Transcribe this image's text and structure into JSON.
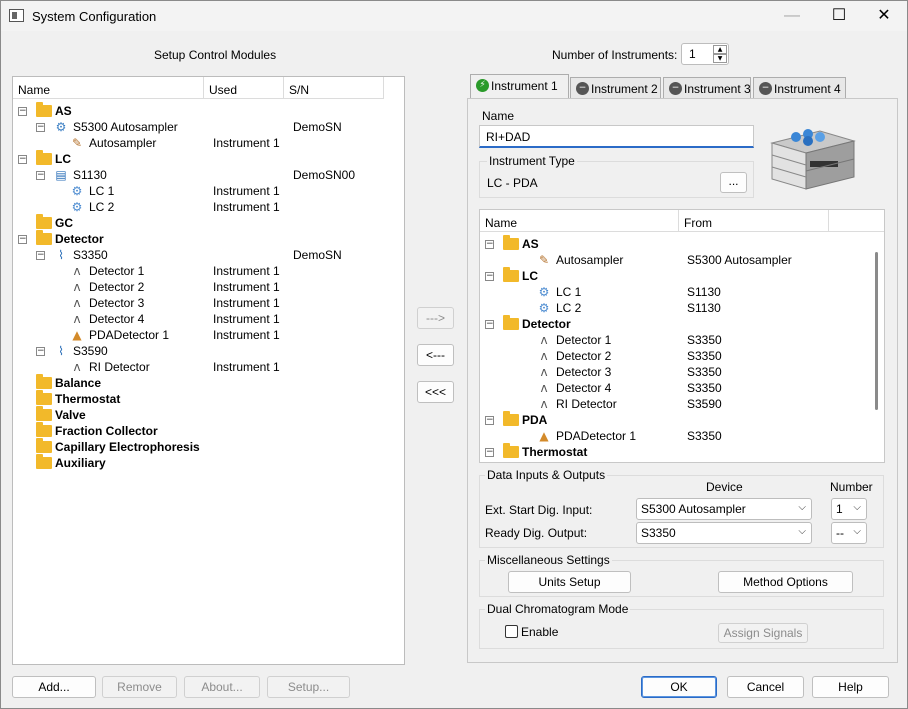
{
  "window": {
    "title": "System Configuration",
    "min_icon": "—",
    "max_icon": "☐",
    "close_icon": "✕"
  },
  "left": {
    "section_title": "Setup Control Modules",
    "columns": [
      "Name",
      "Used",
      "S/N"
    ],
    "rows": [
      {
        "name": "AS",
        "bold": true,
        "kind": "folder",
        "exp": "−",
        "used": "",
        "sn": ""
      },
      {
        "name": "S5300 Autosampler",
        "kind": "autosampler",
        "exp": "−",
        "used": "",
        "sn": "DemoSN"
      },
      {
        "name": "Autosampler",
        "kind": "needle",
        "used": "Instrument 1",
        "sn": ""
      },
      {
        "name": "LC",
        "bold": true,
        "kind": "folder",
        "exp": "−",
        "used": "",
        "sn": ""
      },
      {
        "name": "S1130",
        "kind": "pump",
        "exp": "−",
        "used": "",
        "sn": "DemoSN00"
      },
      {
        "name": "LC 1",
        "kind": "lc",
        "used": "Instrument 1",
        "sn": ""
      },
      {
        "name": "LC 2",
        "kind": "lc",
        "used": "Instrument 1",
        "sn": ""
      },
      {
        "name": "GC",
        "bold": true,
        "kind": "folder",
        "used": "",
        "sn": ""
      },
      {
        "name": "Detector",
        "bold": true,
        "kind": "folder",
        "exp": "−",
        "used": "",
        "sn": ""
      },
      {
        "name": "S3350",
        "kind": "detbox",
        "exp": "−",
        "used": "",
        "sn": "DemoSN"
      },
      {
        "name": "Detector 1",
        "kind": "wave",
        "used": "Instrument 1",
        "sn": ""
      },
      {
        "name": "Detector 2",
        "kind": "wave",
        "used": "Instrument 1",
        "sn": ""
      },
      {
        "name": "Detector 3",
        "kind": "wave",
        "used": "Instrument 1",
        "sn": ""
      },
      {
        "name": "Detector 4",
        "kind": "wave",
        "used": "Instrument 1",
        "sn": ""
      },
      {
        "name": "PDADetector 1",
        "kind": "pda",
        "used": "Instrument 1",
        "sn": ""
      },
      {
        "name": "S3590",
        "kind": "detbox",
        "exp": "−",
        "used": "",
        "sn": ""
      },
      {
        "name": "RI Detector",
        "kind": "wave",
        "used": "Instrument 1",
        "sn": ""
      },
      {
        "name": "Balance",
        "bold": true,
        "kind": "folder",
        "used": "",
        "sn": ""
      },
      {
        "name": "Thermostat",
        "bold": true,
        "kind": "folder",
        "used": "",
        "sn": ""
      },
      {
        "name": "Valve",
        "bold": true,
        "kind": "folder",
        "used": "",
        "sn": ""
      },
      {
        "name": "Fraction Collector",
        "bold": true,
        "kind": "folder",
        "used": "",
        "sn": ""
      },
      {
        "name": "Capillary Electrophoresis",
        "bold": true,
        "kind": "folder",
        "used": "",
        "sn": ""
      },
      {
        "name": "Auxiliary",
        "bold": true,
        "kind": "folder",
        "used": "",
        "sn": ""
      }
    ],
    "buttons": {
      "add": "Add...",
      "remove": "Remove",
      "about": "About...",
      "setup": "Setup..."
    }
  },
  "middle": {
    "assign": "--->",
    "unassign": "<---",
    "unassign_all": "<<<"
  },
  "instruments": {
    "count_label": "Number of Instruments:",
    "count": "1",
    "tabs": [
      {
        "label": "Instrument 1",
        "icon": "⚡",
        "active": true
      },
      {
        "label": "Instrument 2",
        "icon": "−"
      },
      {
        "label": "Instrument 3",
        "icon": "−"
      },
      {
        "label": "Instrument 4",
        "icon": "−"
      }
    ],
    "name_label": "Name",
    "name_value": "RI+DAD",
    "type_group": "Instrument Type",
    "type_value": "LC - PDA",
    "type_button": "...",
    "columns": [
      "Name",
      "From"
    ],
    "rows": [
      {
        "name": "AS",
        "bold": true,
        "kind": "folder",
        "exp": "−",
        "from": ""
      },
      {
        "name": "Autosampler",
        "kind": "needle",
        "from": "S5300 Autosampler"
      },
      {
        "name": "LC",
        "bold": true,
        "kind": "folder",
        "exp": "−",
        "from": ""
      },
      {
        "name": "LC 1",
        "kind": "lc",
        "from": "S1130"
      },
      {
        "name": "LC 2",
        "kind": "lc",
        "from": "S1130"
      },
      {
        "name": "Detector",
        "bold": true,
        "kind": "folder",
        "exp": "−",
        "from": ""
      },
      {
        "name": "Detector 1",
        "kind": "wave",
        "from": "S3350"
      },
      {
        "name": "Detector 2",
        "kind": "wave",
        "from": "S3350"
      },
      {
        "name": "Detector 3",
        "kind": "wave",
        "from": "S3350"
      },
      {
        "name": "Detector 4",
        "kind": "wave",
        "from": "S3350"
      },
      {
        "name": "RI Detector",
        "kind": "wave",
        "from": "S3590"
      },
      {
        "name": "PDA",
        "bold": true,
        "kind": "folder",
        "exp": "−",
        "from": ""
      },
      {
        "name": "PDADetector 1",
        "kind": "pda",
        "from": "S3350"
      },
      {
        "name": "Thermostat",
        "bold": true,
        "kind": "folder",
        "exp": "−",
        "from": ""
      }
    ],
    "io": {
      "group": "Data Inputs & Outputs",
      "device_header": "Device",
      "number_header": "Number",
      "ext_label": "Ext. Start Dig. Input:",
      "ext_device": "S5300 Autosampler",
      "ext_number": "1",
      "ready_label": "Ready Dig. Output:",
      "ready_device": "S3350",
      "ready_number": "--"
    },
    "misc": {
      "group": "Miscellaneous Settings",
      "units": "Units Setup",
      "method": "Method Options"
    },
    "dual": {
      "group": "Dual Chromatogram Mode",
      "enable": "Enable",
      "enabled": false,
      "assign": "Assign Signals"
    }
  },
  "footer": {
    "ok": "OK",
    "cancel": "Cancel",
    "help": "Help"
  }
}
